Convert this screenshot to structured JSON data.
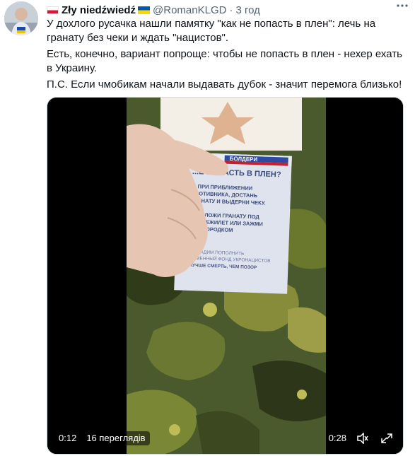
{
  "author": {
    "display_name": "Zły niedźwiedź",
    "handle": "@RomanKLGD",
    "separator": "·",
    "time": "3 год"
  },
  "tweet": {
    "paragraphs": [
      "У дохлого русачка нашли памятку \"как не попасть в плен\": лечь на гранату без чеки и ждать \"нацистов\".",
      "Есть, конечно, вариант попроще: чтобы не попасть в плен - нехер ехать в Украину.",
      "П.С. Если чмобикам начали выдавать дубок - значит перемога близько!"
    ]
  },
  "video": {
    "elapsed": "0:12",
    "views": "16 переглядів",
    "remaining": "0:28"
  },
  "leaflet": {
    "brand": "БОЛДЕРИ",
    "title": "...Е ПОПАСТЬ В ПЛЕН?",
    "item1": [
      "1. ПРИ ПРИБЛИЖЕНИИ",
      "ПРОТИВНИКА, ДОСТАНЬ",
      "ГРАНАТУ И ВЫДЕРНИ ЧЕКУ."
    ],
    "item2": [
      "2. ПОЛОЖИ ГРАНАТУ ПОД",
      "БРОНЕЖИЛЕТ ИЛИ ЗАЖМИ",
      "ПОДБОРОДКОМ"
    ],
    "footer": [
      "НЕ ДАДИМ ПОПОЛНИТЬ",
      "ОБМЕННЫЙ ФОНД УКРОНАЦИСТОВ",
      "ЛУЧШЕ СМЕРТЬ, ЧЕМ ПОЗОР"
    ]
  },
  "colors": {
    "text": "#0f1419",
    "muted": "#536471",
    "camo_base": "#4a5a2c",
    "leaflet_paper": "#dfe3ee"
  },
  "icons": [
    "poland-flag-icon",
    "ukraine-flag-icon",
    "more-icon",
    "volume-icon",
    "fullscreen-icon"
  ]
}
